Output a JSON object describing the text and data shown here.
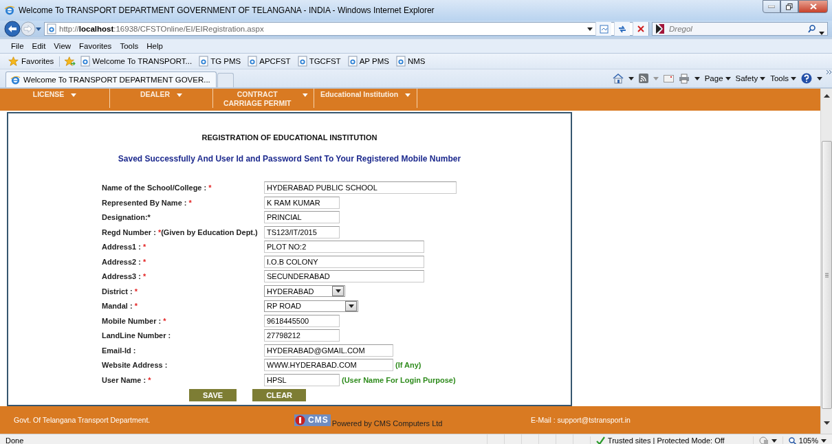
{
  "window": {
    "title": "Welcome To TRANSPORT DEPARTMENT GOVERNMENT OF TELANGANA - INDIA - Windows Internet Explorer"
  },
  "address_bar": {
    "url": "http://**localhost**:16938/CFSTOnline/EI/EIRegistration.aspx"
  },
  "search": {
    "placeholder": "Dregol"
  },
  "menu_bar": [
    "File",
    "Edit",
    "View",
    "Favorites",
    "Tools",
    "Help"
  ],
  "favorites_bar": {
    "label": "Favorites",
    "links": [
      "Welcome To TRANSPORT...",
      "TG PMS",
      "APCFST",
      "TGCFST",
      "AP PMS",
      "NMS"
    ]
  },
  "tabs": [
    {
      "label": "Welcome To TRANSPORT DEPARTMENT GOVER...",
      "selected": true
    }
  ],
  "command_bar": [
    "Page",
    "Safety",
    "Tools"
  ],
  "site_nav": [
    "LICENSE",
    "DEALER",
    "CONTRACT CARRIAGE PERMIT",
    "Educational Institution"
  ],
  "form": {
    "title": "REGISTRATION OF EDUCATIONAL INSTITUTION",
    "message": "Saved Successfully And User Id and Password Sent To Your Registered Mobile Number",
    "fields": [
      {
        "label": "Name of the School/College : ",
        "star": "*",
        "kind": "text",
        "value": "HYDERABAD PUBLIC SCHOOL"
      },
      {
        "label": "Represented By Name : ",
        "star": "*",
        "kind": "text",
        "value": "K RAM KUMAR"
      },
      {
        "label": "Designation:*",
        "kind": "text",
        "value": "PRINCIAL"
      },
      {
        "label": "Regd Number : ",
        "star": "*",
        "note": "(Given by Education Dept.)",
        "kind": "text",
        "value": "TS123/IT/2015"
      },
      {
        "label": "Address1 : ",
        "star": "*",
        "kind": "text",
        "value": "PLOT NO:2"
      },
      {
        "label": "Address2 : ",
        "star": "*",
        "kind": "text",
        "value": "I.O.B COLONY"
      },
      {
        "label": "Address3 : ",
        "star": "*",
        "kind": "text",
        "value": "SECUNDERABAD"
      },
      {
        "label": "District : ",
        "star": "*",
        "kind": "select",
        "value": "HYDERABAD"
      },
      {
        "label": "Mandal : ",
        "star": "*",
        "kind": "select",
        "value": "RP ROAD"
      },
      {
        "label": "Mobile Number : ",
        "star": "*",
        "kind": "text",
        "value": "9618445500"
      },
      {
        "label": "LandLine Number :",
        "kind": "text",
        "value": "27798212"
      },
      {
        "label": "Email-Id :",
        "kind": "text",
        "value": "HYDERABAD@GMAIL.COM"
      },
      {
        "label": "Website Address :",
        "kind": "text",
        "value": "WWW.HYDERABAD.COM",
        "hint": "(If Any)"
      },
      {
        "label": "User Name : ",
        "star": "*",
        "kind": "text",
        "value": "HPSL",
        "hint": "(User Name For Login Purpose)"
      }
    ],
    "buttons": [
      "SAVE",
      "CLEAR"
    ]
  },
  "footer": {
    "left": "Govt. Of Telangana Transport Department.",
    "logo_text": "CMS",
    "powered_by": "Powered by CMS Computers Ltd",
    "email": "E-Mail : support@tstransport.in"
  },
  "status_bar": {
    "status": "Done",
    "zone": "Trusted sites | Protected Mode: Off",
    "zoom": "105%"
  }
}
